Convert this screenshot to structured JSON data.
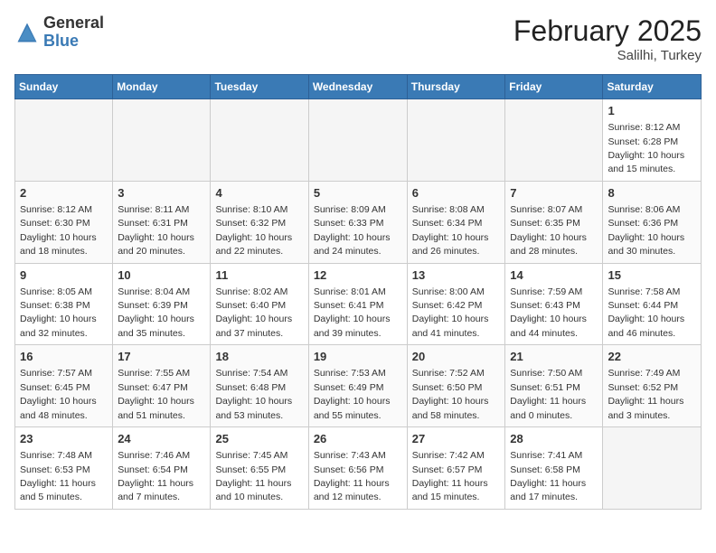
{
  "logo": {
    "general": "General",
    "blue": "Blue"
  },
  "title": {
    "month_year": "February 2025",
    "location": "Salilhi, Turkey"
  },
  "days_of_week": [
    "Sunday",
    "Monday",
    "Tuesday",
    "Wednesday",
    "Thursday",
    "Friday",
    "Saturday"
  ],
  "weeks": [
    [
      {
        "day": "",
        "info": "",
        "empty": true
      },
      {
        "day": "",
        "info": "",
        "empty": true
      },
      {
        "day": "",
        "info": "",
        "empty": true
      },
      {
        "day": "",
        "info": "",
        "empty": true
      },
      {
        "day": "",
        "info": "",
        "empty": true
      },
      {
        "day": "",
        "info": "",
        "empty": true
      },
      {
        "day": "1",
        "info": "Sunrise: 8:12 AM\nSunset: 6:28 PM\nDaylight: 10 hours\nand 15 minutes."
      }
    ],
    [
      {
        "day": "2",
        "info": "Sunrise: 8:12 AM\nSunset: 6:30 PM\nDaylight: 10 hours\nand 18 minutes."
      },
      {
        "day": "3",
        "info": "Sunrise: 8:11 AM\nSunset: 6:31 PM\nDaylight: 10 hours\nand 20 minutes."
      },
      {
        "day": "4",
        "info": "Sunrise: 8:10 AM\nSunset: 6:32 PM\nDaylight: 10 hours\nand 22 minutes."
      },
      {
        "day": "5",
        "info": "Sunrise: 8:09 AM\nSunset: 6:33 PM\nDaylight: 10 hours\nand 24 minutes."
      },
      {
        "day": "6",
        "info": "Sunrise: 8:08 AM\nSunset: 6:34 PM\nDaylight: 10 hours\nand 26 minutes."
      },
      {
        "day": "7",
        "info": "Sunrise: 8:07 AM\nSunset: 6:35 PM\nDaylight: 10 hours\nand 28 minutes."
      },
      {
        "day": "8",
        "info": "Sunrise: 8:06 AM\nSunset: 6:36 PM\nDaylight: 10 hours\nand 30 minutes."
      }
    ],
    [
      {
        "day": "9",
        "info": "Sunrise: 8:05 AM\nSunset: 6:38 PM\nDaylight: 10 hours\nand 32 minutes."
      },
      {
        "day": "10",
        "info": "Sunrise: 8:04 AM\nSunset: 6:39 PM\nDaylight: 10 hours\nand 35 minutes."
      },
      {
        "day": "11",
        "info": "Sunrise: 8:02 AM\nSunset: 6:40 PM\nDaylight: 10 hours\nand 37 minutes."
      },
      {
        "day": "12",
        "info": "Sunrise: 8:01 AM\nSunset: 6:41 PM\nDaylight: 10 hours\nand 39 minutes."
      },
      {
        "day": "13",
        "info": "Sunrise: 8:00 AM\nSunset: 6:42 PM\nDaylight: 10 hours\nand 41 minutes."
      },
      {
        "day": "14",
        "info": "Sunrise: 7:59 AM\nSunset: 6:43 PM\nDaylight: 10 hours\nand 44 minutes."
      },
      {
        "day": "15",
        "info": "Sunrise: 7:58 AM\nSunset: 6:44 PM\nDaylight: 10 hours\nand 46 minutes."
      }
    ],
    [
      {
        "day": "16",
        "info": "Sunrise: 7:57 AM\nSunset: 6:45 PM\nDaylight: 10 hours\nand 48 minutes."
      },
      {
        "day": "17",
        "info": "Sunrise: 7:55 AM\nSunset: 6:47 PM\nDaylight: 10 hours\nand 51 minutes."
      },
      {
        "day": "18",
        "info": "Sunrise: 7:54 AM\nSunset: 6:48 PM\nDaylight: 10 hours\nand 53 minutes."
      },
      {
        "day": "19",
        "info": "Sunrise: 7:53 AM\nSunset: 6:49 PM\nDaylight: 10 hours\nand 55 minutes."
      },
      {
        "day": "20",
        "info": "Sunrise: 7:52 AM\nSunset: 6:50 PM\nDaylight: 10 hours\nand 58 minutes."
      },
      {
        "day": "21",
        "info": "Sunrise: 7:50 AM\nSunset: 6:51 PM\nDaylight: 11 hours\nand 0 minutes."
      },
      {
        "day": "22",
        "info": "Sunrise: 7:49 AM\nSunset: 6:52 PM\nDaylight: 11 hours\nand 3 minutes."
      }
    ],
    [
      {
        "day": "23",
        "info": "Sunrise: 7:48 AM\nSunset: 6:53 PM\nDaylight: 11 hours\nand 5 minutes."
      },
      {
        "day": "24",
        "info": "Sunrise: 7:46 AM\nSunset: 6:54 PM\nDaylight: 11 hours\nand 7 minutes."
      },
      {
        "day": "25",
        "info": "Sunrise: 7:45 AM\nSunset: 6:55 PM\nDaylight: 11 hours\nand 10 minutes."
      },
      {
        "day": "26",
        "info": "Sunrise: 7:43 AM\nSunset: 6:56 PM\nDaylight: 11 hours\nand 12 minutes."
      },
      {
        "day": "27",
        "info": "Sunrise: 7:42 AM\nSunset: 6:57 PM\nDaylight: 11 hours\nand 15 minutes."
      },
      {
        "day": "28",
        "info": "Sunrise: 7:41 AM\nSunset: 6:58 PM\nDaylight: 11 hours\nand 17 minutes."
      },
      {
        "day": "",
        "info": "",
        "empty": true
      }
    ]
  ]
}
